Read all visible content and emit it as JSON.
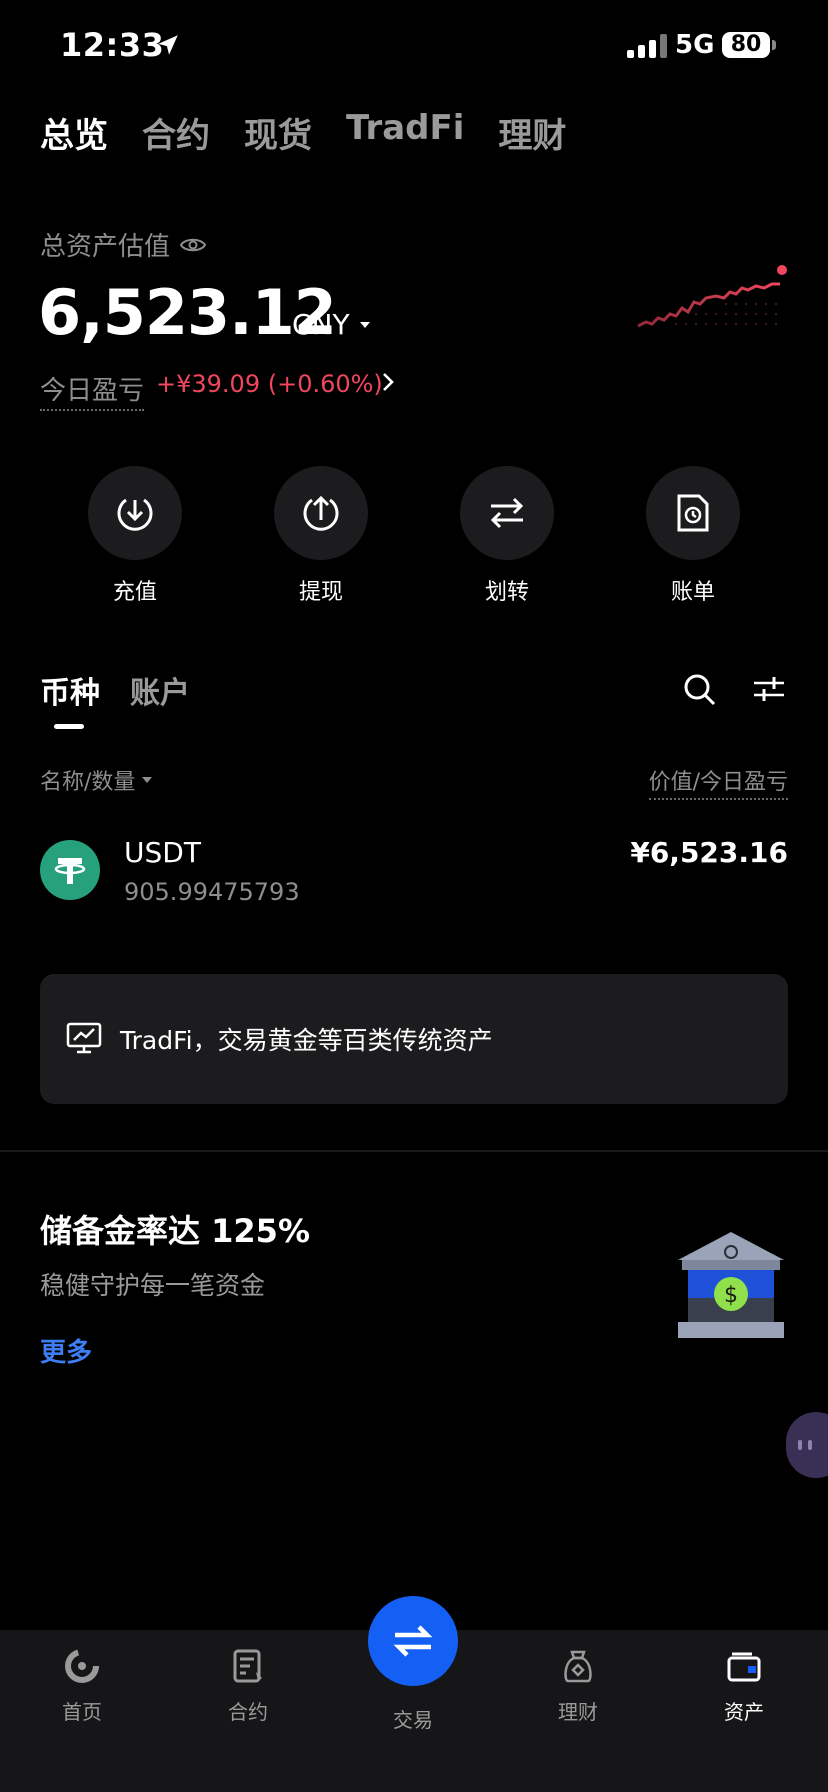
{
  "status": {
    "time": "12:33",
    "network": "5G",
    "battery": "80"
  },
  "top_tabs": [
    "总览",
    "合约",
    "现货",
    "TradFi",
    "理财"
  ],
  "asset": {
    "label": "总资产估值",
    "value": "6,523.12",
    "currency": "CNY",
    "pnl_label": "今日盈亏",
    "pnl_value": "+¥39.09 (+0.60%)"
  },
  "actions": [
    "充值",
    "提现",
    "划转",
    "账单"
  ],
  "list_tabs": [
    "币种",
    "账户"
  ],
  "columns": {
    "left": "名称/数量",
    "right": "价值/今日盈亏"
  },
  "coins": [
    {
      "name": "USDT",
      "quantity": "905.99475793",
      "value": "¥6,523.16"
    }
  ],
  "tradfi_banner": "TradFi，交易黄金等百类传统资产",
  "reserve": {
    "title": "储备金率达 125%",
    "subtitle": "稳健守护每一笔资金",
    "more": "更多"
  },
  "bottom_nav": [
    "首页",
    "合约",
    "交易",
    "理财",
    "资产"
  ],
  "colors": {
    "accent": "#1460f5",
    "loss_gain": "#f0475e",
    "link": "#3d7ef5",
    "usdt": "#26a17b"
  }
}
